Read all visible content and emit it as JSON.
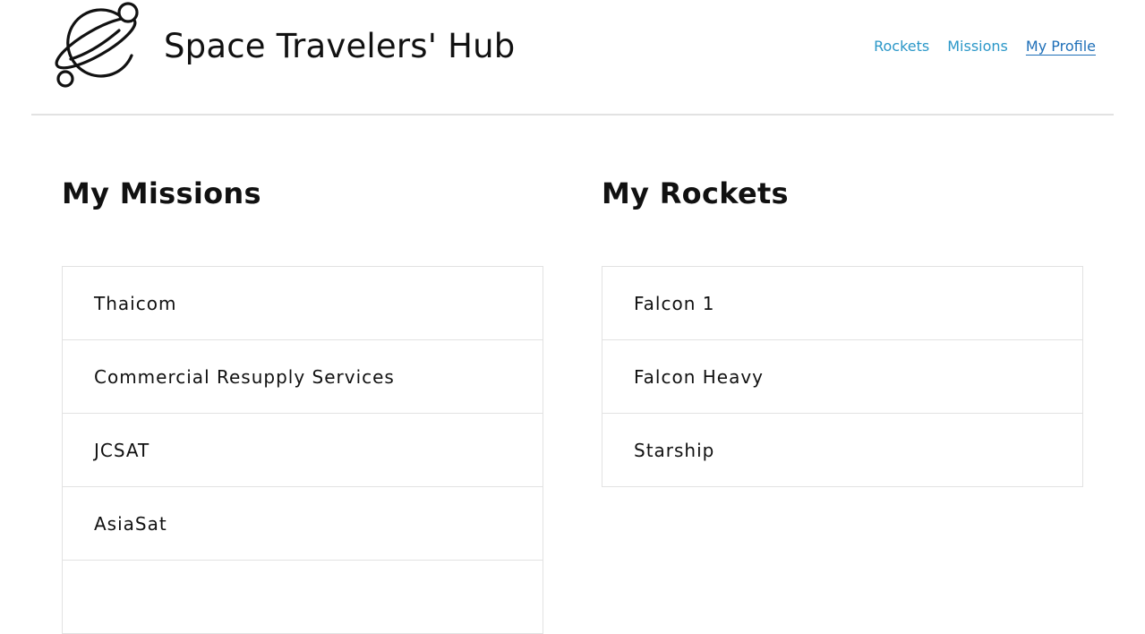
{
  "header": {
    "title": "Space Travelers' Hub",
    "logo_icon": "planet-logo-icon",
    "nav": [
      {
        "label": "Rockets",
        "active": false
      },
      {
        "label": "Missions",
        "active": false
      },
      {
        "label": "My Profile",
        "active": true
      }
    ]
  },
  "missions": {
    "title": "My Missions",
    "items": [
      "Thaicom",
      "Commercial Resupply Services",
      "JCSAT",
      "AsiaSat",
      ""
    ]
  },
  "rockets": {
    "title": "My Rockets",
    "items": [
      "Falcon 1",
      "Falcon Heavy",
      "Starship"
    ]
  },
  "colors": {
    "nav_link": "#2a97c8",
    "nav_active": "#1e6fb8",
    "border": "#e2e2e2",
    "text": "#111111"
  }
}
